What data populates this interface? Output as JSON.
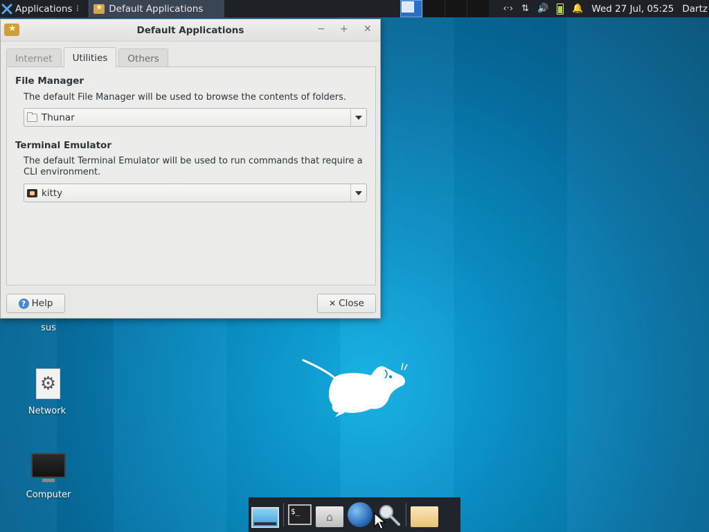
{
  "top_panel": {
    "applications_label": "Applications",
    "applications_separator": "⠇",
    "task_title": "Default Applications",
    "tray": {
      "network_glyph": "‹·›",
      "transfer_glyph": "⇅",
      "volume_glyph": "🔊",
      "bell_glyph": "🔔"
    },
    "clock": "Wed 27 Jul, 05:25",
    "user": "Dartz"
  },
  "window": {
    "title": "Default Applications",
    "controls": {
      "minimize": "−",
      "maximize": "+",
      "close": "✕"
    },
    "tabs": [
      {
        "label": "Internet"
      },
      {
        "label": "Utilities"
      },
      {
        "label": "Others"
      }
    ],
    "file_manager": {
      "title": "File Manager",
      "description": "The default File Manager will be used to browse the contents of folders.",
      "selected": "Thunar"
    },
    "terminal": {
      "title": "Terminal Emulator",
      "description": "The default Terminal Emulator will be used to run commands that require a CLI environment.",
      "selected": "kitty"
    },
    "help_label": "Help",
    "close_label": "Close"
  },
  "desktop": {
    "icons": [
      {
        "label": "sus"
      },
      {
        "label": "Network",
        "icon": "gear-icon"
      },
      {
        "label": "Computer",
        "icon": "monitor-icon"
      }
    ]
  },
  "dock": {
    "terminal_prompt": "$_"
  },
  "colors": {
    "desktop_blue": "#0a8dc4",
    "panel_dark": "#1e2227",
    "window_bg": "#e8e8e7",
    "workspace_active": "#2c6fc6"
  }
}
